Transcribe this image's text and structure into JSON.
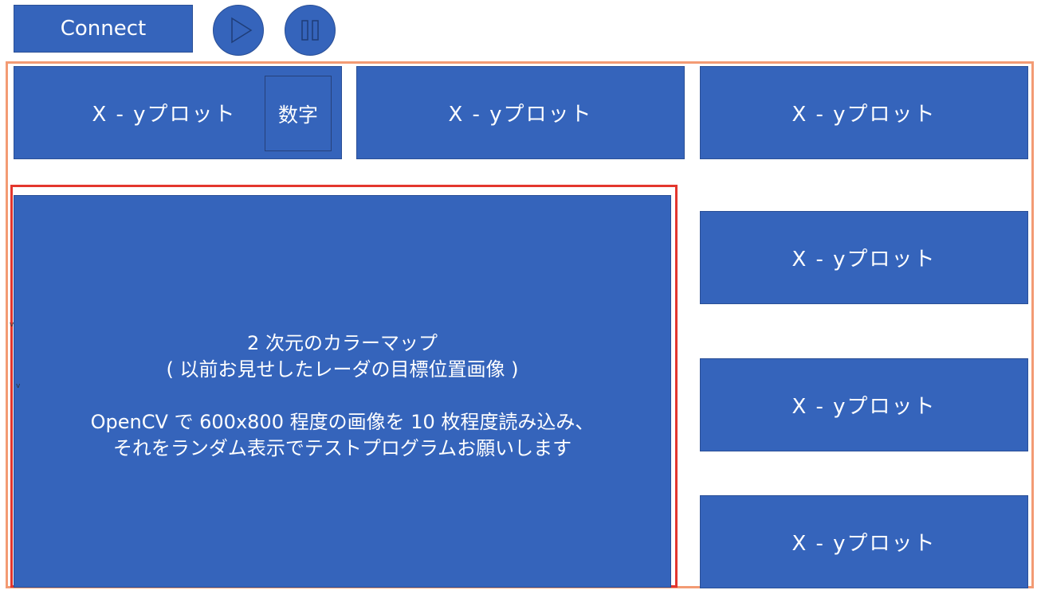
{
  "toolbar": {
    "connect_label": "Connect",
    "play_icon": "play-icon",
    "pause_icon": "pause-icon"
  },
  "plots": [
    {
      "label": "X - yプロット"
    },
    {
      "label": "X - yプロット"
    },
    {
      "label": "X - yプロット"
    },
    {
      "label": "X - yプロット"
    },
    {
      "label": "X - yプロット"
    },
    {
      "label": "X - yプロット"
    }
  ],
  "number_box": {
    "label": "数字"
  },
  "colormap": {
    "line1": "2 次元のカラーマップ",
    "line2": "( 以前お見せしたレーダの目標位置画像 )",
    "line3": "OpenCV で 600x800 程度の画像を 10 枚程度読み込み、",
    "line4": "それをランダム表示でテストプログラムお願いします"
  },
  "stray_marks": [
    "v",
    "v"
  ],
  "colors": {
    "panel": "#3564bb",
    "outer_frame": "#f39b74",
    "inner_frame": "#e3362d"
  }
}
